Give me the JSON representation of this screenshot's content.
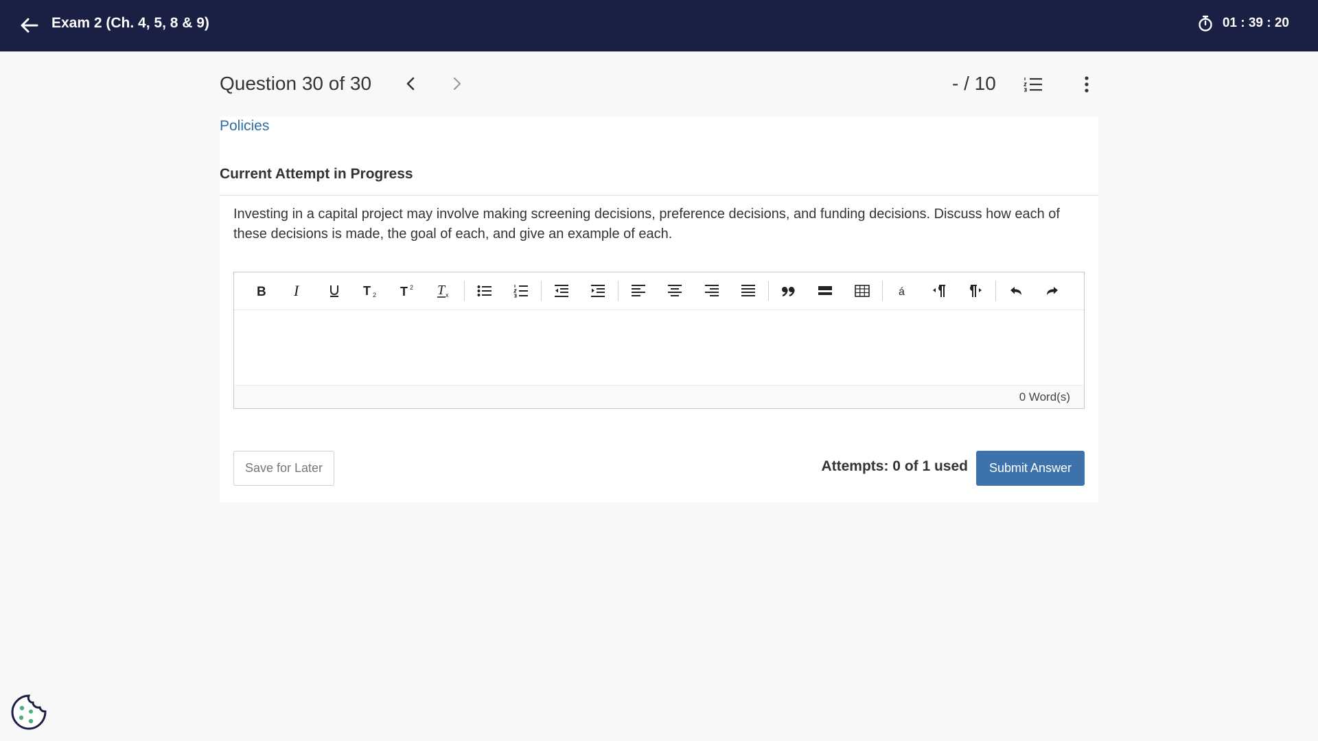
{
  "topbar": {
    "title": "Exam 2 (Ch. 4, 5, 8 & 9)",
    "timer": "01 : 39 : 20",
    "back_icon": "arrow-left-icon",
    "timer_icon": "stopwatch-icon"
  },
  "question": {
    "counter": "Question 30 of 30",
    "score": "- / 10",
    "prev_icon": "chevron-left-icon",
    "next_icon": "chevron-right-icon",
    "list_icon": "numbered-list-icon",
    "more_icon": "more-vertical-icon"
  },
  "card": {
    "policies_link": "Policies",
    "attempt_heading": "Current Attempt in Progress",
    "prompt": "Investing in a capital project may involve making screening decisions, preference decisions, and funding decisions. Discuss how each of these decisions is made, the goal of each, and give an example of each."
  },
  "editor": {
    "toolbar": [
      {
        "name": "bold",
        "glyph": "B"
      },
      {
        "name": "italic",
        "glyph": "I"
      },
      {
        "name": "underline",
        "glyph": "U"
      },
      {
        "name": "subscript",
        "glyph": "T₂"
      },
      {
        "name": "superscript",
        "glyph": "T²"
      },
      {
        "name": "remove-format",
        "glyph": "Tx"
      },
      {
        "name": "bulleted-list",
        "glyph": ""
      },
      {
        "name": "numbered-list",
        "glyph": ""
      },
      {
        "name": "outdent",
        "glyph": ""
      },
      {
        "name": "indent",
        "glyph": ""
      },
      {
        "name": "align-left",
        "glyph": ""
      },
      {
        "name": "align-center",
        "glyph": ""
      },
      {
        "name": "align-right",
        "glyph": ""
      },
      {
        "name": "align-justify",
        "glyph": ""
      },
      {
        "name": "blockquote",
        "glyph": "❞"
      },
      {
        "name": "horizontal-rule",
        "glyph": ""
      },
      {
        "name": "table",
        "glyph": ""
      },
      {
        "name": "special-character",
        "glyph": "á"
      },
      {
        "name": "ltr",
        "glyph": "¶"
      },
      {
        "name": "rtl",
        "glyph": "¶"
      },
      {
        "name": "undo",
        "glyph": "↶"
      },
      {
        "name": "redo",
        "glyph": "↷"
      }
    ],
    "word_count": "0 Word(s)",
    "content": ""
  },
  "actions": {
    "save_label": "Save for Later",
    "attempts_text": "Attempts: 0 of 1 used",
    "submit_label": "Submit Answer"
  },
  "footer": {
    "cookie_icon": "cookie-icon",
    "cookie_color": "#4caf7d"
  },
  "colors": {
    "topbar": "#1a1f44",
    "link": "#2e6da4",
    "primary_button": "#3d72ad",
    "background": "#f9f8f8"
  }
}
